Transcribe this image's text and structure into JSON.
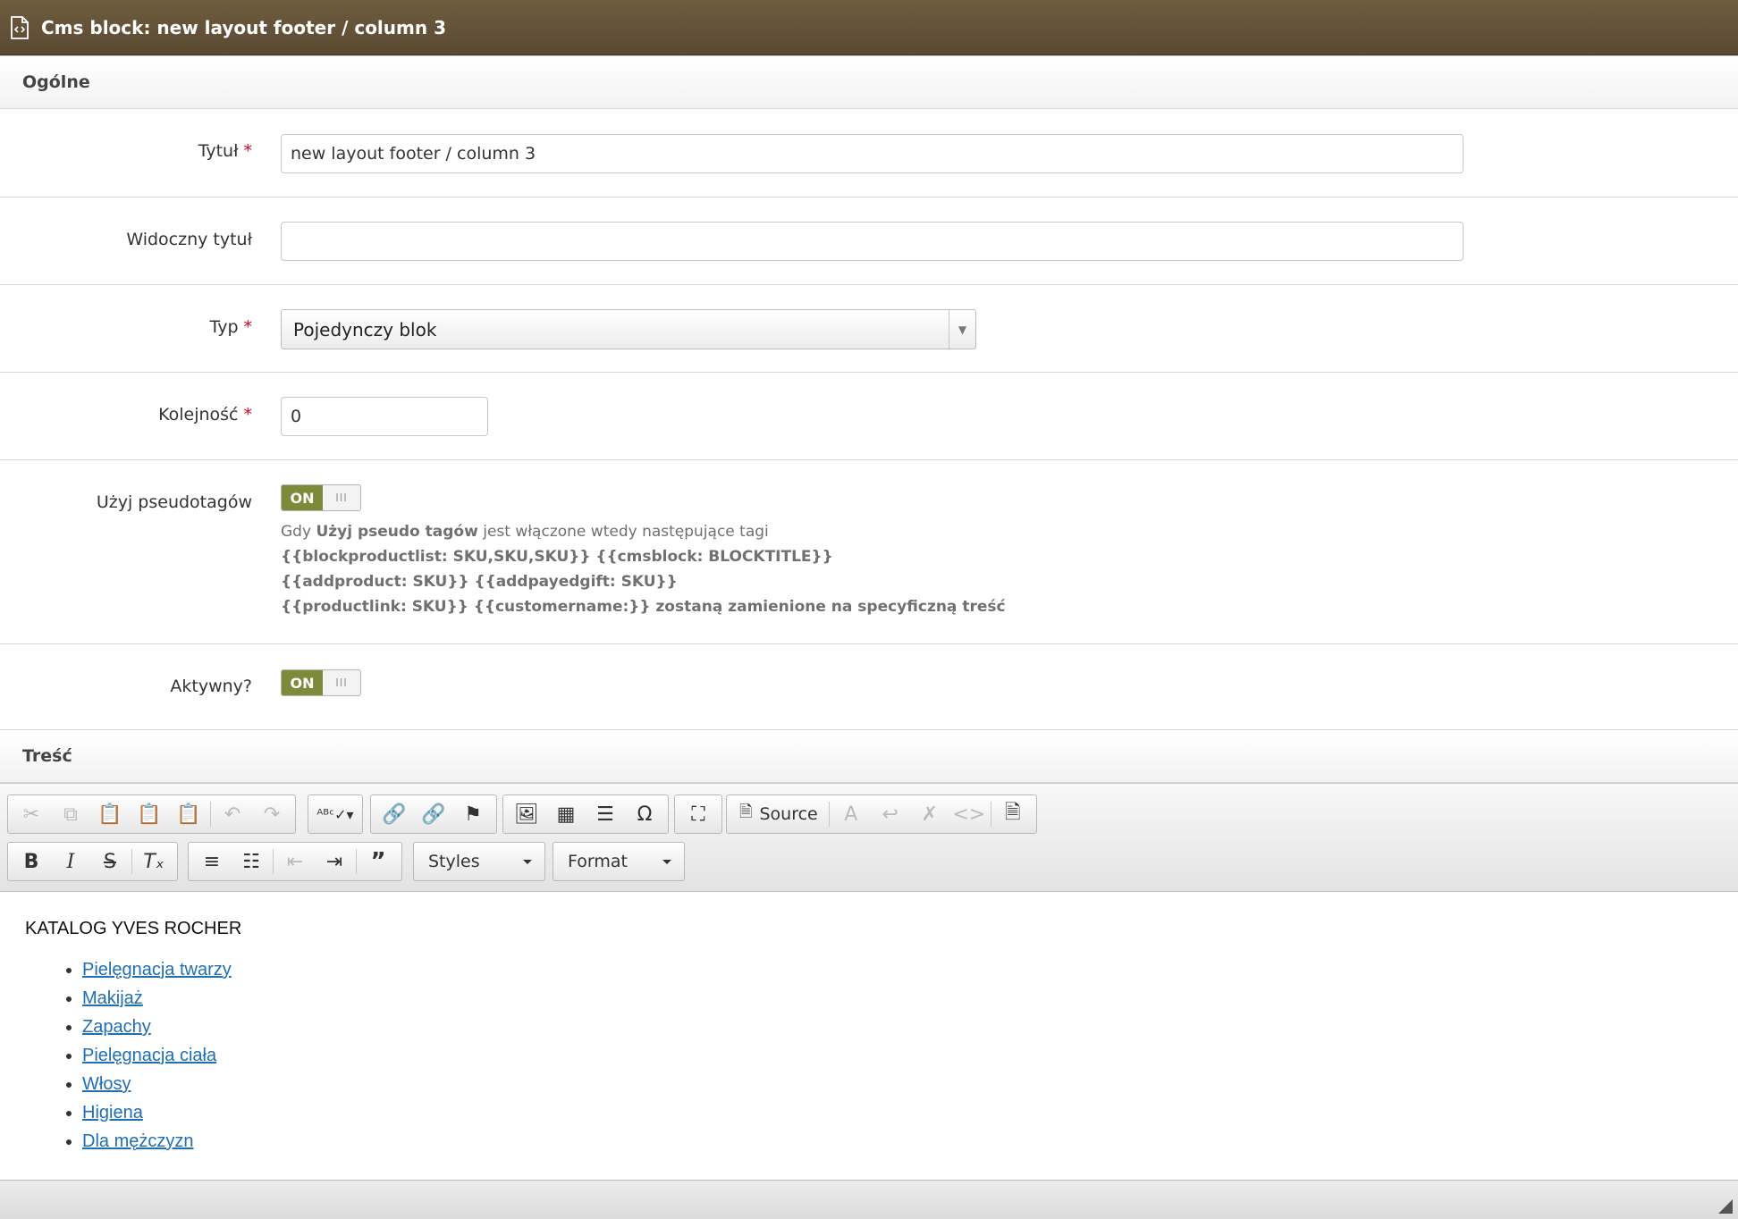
{
  "window": {
    "title": "Cms block: new layout footer / column 3",
    "icon": "code-file-icon"
  },
  "sections": {
    "general": "Ogólne",
    "content": "Treść"
  },
  "form": {
    "title_label": "Tytuł",
    "title_value": "new layout footer / column 3",
    "visible_title_label": "Widoczny tytuł",
    "visible_title_value": "",
    "type_label": "Typ",
    "type_value": "Pojedynczy blok",
    "order_label": "Kolejność",
    "order_value": "0",
    "pseudotags_label": "Użyj pseudotagów",
    "pseudotags_toggle": "ON",
    "help_prefix": "Gdy ",
    "help_bold": "Użyj pseudo tagów",
    "help_suffix": " jest włączone wtedy następujące tagi",
    "help_line2": "{{blockproductlist: SKU,SKU,SKU}} {{cmsblock: BLOCKTITLE}}",
    "help_line3": "{{addproduct: SKU}} {{addpayedgift: SKU}}",
    "help_line4": "{{productlink: SKU}} {{customername:}} zostaną zamienione na specyficzną treść",
    "active_label": "Aktywny?",
    "active_toggle": "ON",
    "required_mark": "*"
  },
  "editor": {
    "source_label": "Source",
    "styles_label": "Styles",
    "format_label": "Format",
    "content_heading": "KATALOG YVES ROCHER",
    "links": [
      "Pielęgnacja twarzy",
      "Makijaż",
      "Zapachy",
      "Pielęgnacja ciała",
      "Włosy",
      "Higiena",
      "Dla mężczyzn"
    ]
  },
  "colors": {
    "titlebar": "#5f4e36",
    "toggle_on": "#7e8a3a",
    "link": "#1f6fb5",
    "required": "#d0021b"
  }
}
